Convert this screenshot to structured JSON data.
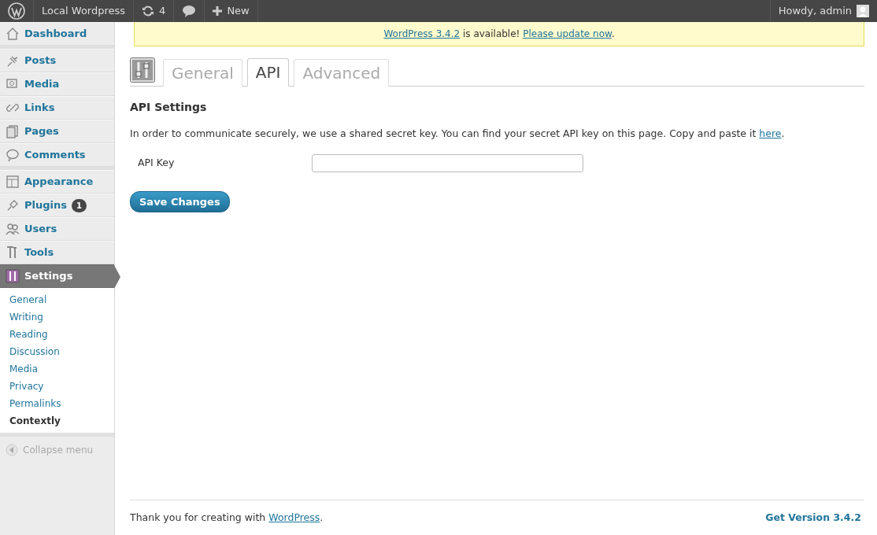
{
  "admin_bar": {
    "site": "Local Wordpress",
    "updates": "4",
    "new": "New",
    "greeting": "Howdy, admin"
  },
  "sidebar": {
    "groups": [
      [
        {
          "label": "Dashboard",
          "selected": false
        }
      ],
      [
        {
          "label": "Posts",
          "selected": false
        },
        {
          "label": "Media",
          "selected": false
        },
        {
          "label": "Links",
          "selected": false
        },
        {
          "label": "Pages",
          "selected": false
        },
        {
          "label": "Comments",
          "selected": false
        }
      ],
      [
        {
          "label": "Appearance",
          "selected": false
        },
        {
          "label": "Plugins",
          "selected": false,
          "badge": "1"
        },
        {
          "label": "Users",
          "selected": false
        },
        {
          "label": "Tools",
          "selected": false
        },
        {
          "label": "Settings",
          "selected": true,
          "children": [
            {
              "label": "General",
              "selected": false
            },
            {
              "label": "Writing",
              "selected": false
            },
            {
              "label": "Reading",
              "selected": false
            },
            {
              "label": "Discussion",
              "selected": false
            },
            {
              "label": "Media",
              "selected": false
            },
            {
              "label": "Privacy",
              "selected": false
            },
            {
              "label": "Permalinks",
              "selected": false
            },
            {
              "label": "Contextly",
              "selected": true
            }
          ]
        }
      ]
    ],
    "collapse": "Collapse menu"
  },
  "notice": [
    {
      "kind": "link",
      "text": "WordPress 3.4.2"
    },
    {
      "kind": "text",
      "text": " is available! "
    },
    {
      "kind": "link",
      "text": "Please update now"
    },
    {
      "kind": "text",
      "text": "."
    }
  ],
  "tabs": [
    {
      "label": "General",
      "selected": false
    },
    {
      "label": "API",
      "selected": true
    },
    {
      "label": "Advanced",
      "selected": false
    }
  ],
  "section_title": "API Settings",
  "description": [
    {
      "kind": "text",
      "text": "In order to communicate securely, we use a shared secret key. You can find your secret API key on this page. Copy and paste it "
    },
    {
      "kind": "link",
      "text": "here"
    },
    {
      "kind": "text",
      "text": "."
    }
  ],
  "fields": [
    {
      "label": "API Key"
    }
  ],
  "save_button": "Save Changes",
  "footer": {
    "thanks": [
      {
        "kind": "text",
        "text": "Thank you for creating with "
      },
      {
        "kind": "link",
        "text": "WordPress"
      },
      {
        "kind": "text",
        "text": "."
      }
    ],
    "version": "Get Version 3.4.2"
  }
}
